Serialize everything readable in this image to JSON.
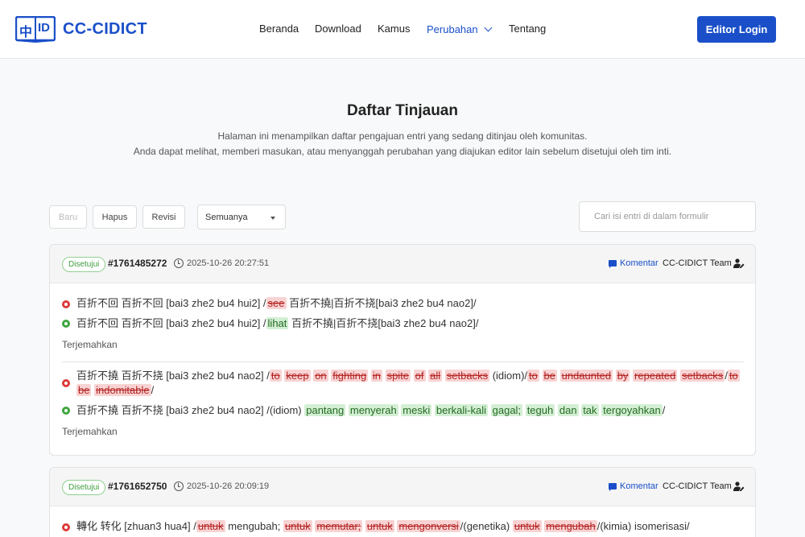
{
  "header": {
    "logo_glyph": "中",
    "logo_id": "ID",
    "logo_text": "CC-CIDICT",
    "nav": [
      "Beranda",
      "Download",
      "Kamus",
      "Perubahan",
      "Tentang"
    ],
    "login": "Editor Login"
  },
  "intro": {
    "title": "Daftar Tinjauan",
    "line1": "Halaman ini menampilkan daftar pengajuan entri yang sedang ditinjau oleh komunitas.",
    "line2": "Anda dapat melihat, memberi masukan, atau menyanggah perubahan yang diajukan editor lain sebelum disetujui oleh tim inti."
  },
  "toolbar": {
    "new": "Baru",
    "delete": "Hapus",
    "revision": "Revisi",
    "filter": "Semuanya",
    "search_placeholder": "Cari isi entri di dalam formulir"
  },
  "cards": [
    {
      "badge": "Disetujui",
      "id": "#1761485272",
      "date": "2025-10-26 20:27:51",
      "comment": "Komentar",
      "team": "CC-CIDICT Team",
      "translate": "Terjemahkan",
      "g1": {
        "old_pre": "百折不回 百折不回 [bai3 zhe2 bu4 hui2] /",
        "old_del": "see",
        "old_post": " 百折不撓|百折不挠[bai3 zhe2 bu4 nao2]/",
        "new_pre": "百折不回 百折不回 [bai3 zhe2 bu4 hui2] /",
        "new_add": "lihat",
        "new_post": " 百折不撓|百折不挠[bai3 zhe2 bu4 nao2]/"
      },
      "g2": {
        "old_pre": "百折不撓 百折不挠 [bai3 zhe2 bu4 nao2] /",
        "old_del1": [
          "to",
          "keep",
          "on",
          "fighting",
          "in",
          "spite",
          "of",
          "all",
          "setbacks"
        ],
        "old_mid": " (idiom)/",
        "old_del2": [
          "to",
          "be",
          "undaunted",
          "by",
          "repeated",
          "setbacks"
        ],
        "old_slash": "/",
        "old_del3": [
          "to",
          "be",
          "indomitable"
        ],
        "old_end": "/",
        "new_pre": "百折不撓 百折不挠 [bai3 zhe2 bu4 nao2] /(idiom) ",
        "new_add": [
          "pantang",
          "menyerah",
          "meski",
          "berkali-kali",
          "gagal;",
          "teguh",
          "dan",
          "tak",
          "tergoyahkan"
        ],
        "new_end": "/"
      }
    },
    {
      "badge": "Disetujui",
      "id": "#1761652750",
      "date": "2025-10-26 20:09:19",
      "comment": "Komentar",
      "team": "CC-CIDICT Team",
      "line_pre": "轉化 转化 [zhuan3 hua4] /",
      "del_a": "untuk",
      "txt_a": " mengubah; ",
      "del_b": [
        "untuk",
        "memutar;",
        "untuk",
        "mengonversi"
      ],
      "txt_b": "/(genetika) ",
      "del_c": [
        "untuk",
        "mengubah"
      ],
      "txt_c": "/(kimia) isomerisasi/"
    }
  ]
}
